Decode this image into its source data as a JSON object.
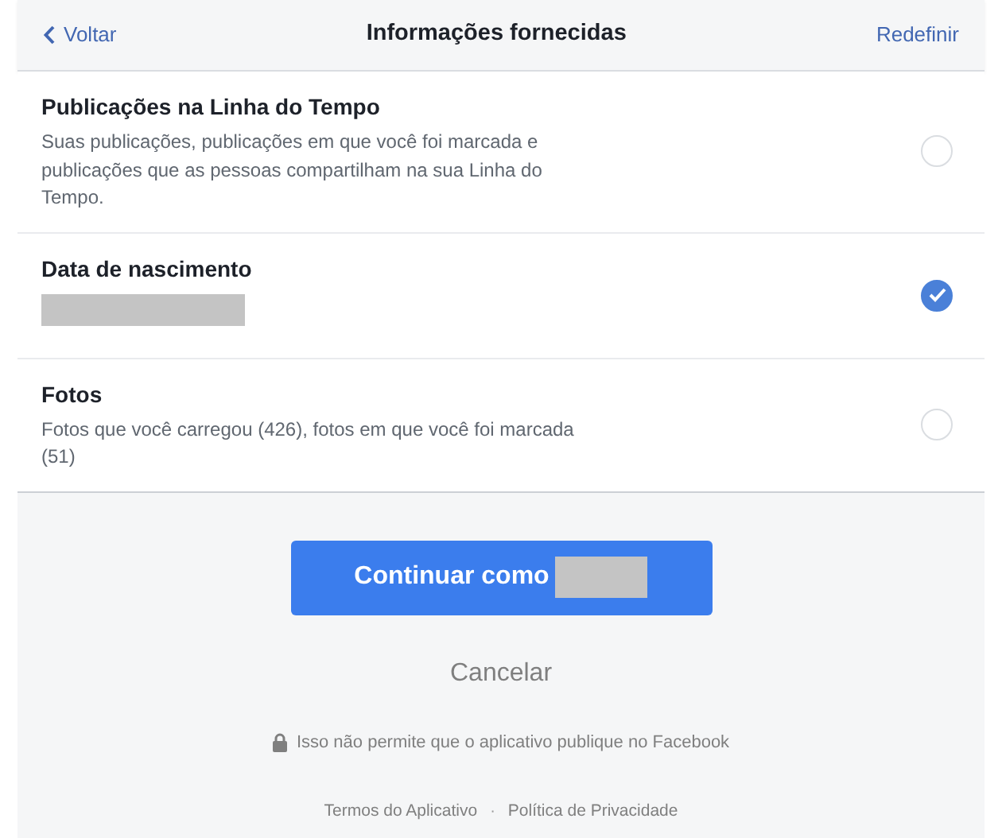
{
  "header": {
    "back": "Voltar",
    "title": "Informações fornecidas",
    "reset": "Redefinir"
  },
  "items": [
    {
      "kind": "text",
      "title": "Publicações na Linha do Tempo",
      "description": "Suas publicações, publicações em que você foi marcada e publicações que as pessoas compartilham na sua Linha do Tempo.",
      "selected": false
    },
    {
      "kind": "redacted",
      "title": "Data de nascimento",
      "selected": true
    },
    {
      "kind": "text",
      "title": "Fotos",
      "description": "Fotos que você carregou (426), fotos em que você foi marcada (51)",
      "selected": false
    }
  ],
  "continue_button": {
    "label": "Continuar como",
    "name_redacted": true
  },
  "cancel": "Cancelar",
  "notice": "Isso não permite que o aplicativo publique no Facebook",
  "footer_links": [
    "Termos do Aplicativo",
    "Política de Privacidade"
  ],
  "footer_separator": "·"
}
